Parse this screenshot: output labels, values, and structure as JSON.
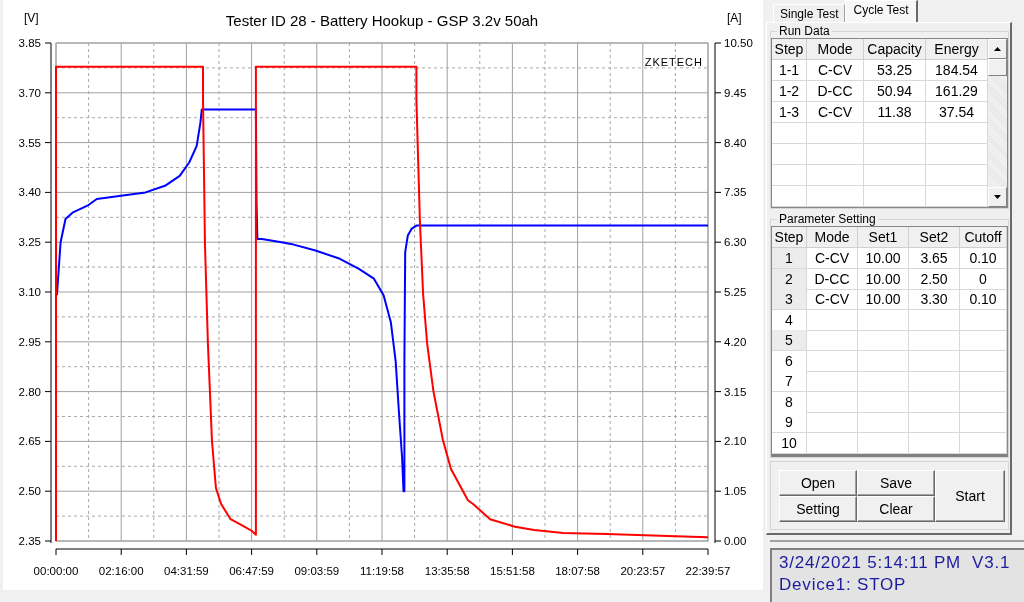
{
  "chart": {
    "brand": "ZKETECH",
    "chart_data": {
      "type": "line",
      "title": "Tester ID 28 - Battery Hookup - GSP 3.2v 50ah",
      "ylabel": "[V]",
      "y2label": "[A]",
      "grid": true,
      "xlim": [
        0,
        81597
      ],
      "ylim": [
        2.35,
        3.85
      ],
      "y2lim": [
        0,
        10.5
      ],
      "xticks": [
        {
          "value": 0,
          "label": "00:00:00"
        },
        {
          "value": 8160,
          "label": "02:16:00"
        },
        {
          "value": 16319,
          "label": "04:31:59"
        },
        {
          "value": 24479,
          "label": "06:47:59"
        },
        {
          "value": 32639,
          "label": "09:03:59"
        },
        {
          "value": 40798,
          "label": "11:19:58"
        },
        {
          "value": 48958,
          "label": "13:35:58"
        },
        {
          "value": 57118,
          "label": "15:51:58"
        },
        {
          "value": 65278,
          "label": "18:07:58"
        },
        {
          "value": 73437,
          "label": "20:23:57"
        },
        {
          "value": 81597,
          "label": "22:39:57"
        }
      ],
      "yticks": [
        {
          "value": 3.85,
          "label": "3.85"
        },
        {
          "value": 3.7,
          "label": "3.70"
        },
        {
          "value": 3.55,
          "label": "3.55"
        },
        {
          "value": 3.4,
          "label": "3.40"
        },
        {
          "value": 3.25,
          "label": "3.25"
        },
        {
          "value": 3.1,
          "label": "3.10"
        },
        {
          "value": 2.95,
          "label": "2.95"
        },
        {
          "value": 2.8,
          "label": "2.80"
        },
        {
          "value": 2.65,
          "label": "2.65"
        },
        {
          "value": 2.5,
          "label": "2.50"
        },
        {
          "value": 2.35,
          "label": "2.35"
        }
      ],
      "y2ticks": [
        {
          "value": 10.5,
          "label": "10.50"
        },
        {
          "value": 9.45,
          "label": "9.45"
        },
        {
          "value": 8.4,
          "label": "8.40"
        },
        {
          "value": 7.35,
          "label": "7.35"
        },
        {
          "value": 6.3,
          "label": "6.30"
        },
        {
          "value": 5.25,
          "label": "5.25"
        },
        {
          "value": 4.2,
          "label": "4.20"
        },
        {
          "value": 3.15,
          "label": "3.15"
        },
        {
          "value": 2.1,
          "label": "2.10"
        },
        {
          "value": 1.05,
          "label": "1.05"
        },
        {
          "value": 0,
          "label": "0.00"
        }
      ],
      "series": [
        {
          "color": "#0000ff",
          "x": [
            108,
            288,
            576,
            1188,
            2124,
            3924,
            5112,
            8136,
            11196,
            13644,
            15480,
            16668,
            17604,
            18072,
            18252,
            25020,
            25092,
            25200,
            25776,
            28224,
            29412,
            32472,
            35532,
            37908,
            39780,
            41004,
            41904,
            42516,
            42912,
            43308,
            43488,
            43596,
            43596,
            43704,
            44028,
            44496,
            45108,
            81597
          ],
          "values": [
            3.09,
            3.15,
            3.25,
            3.32,
            3.34,
            3.36,
            3.38,
            3.39,
            3.4,
            3.42,
            3.45,
            3.49,
            3.54,
            3.61,
            3.65,
            3.65,
            3.37,
            3.26,
            3.26,
            3.25,
            3.245,
            3.225,
            3.2,
            3.17,
            3.14,
            3.09,
            3.01,
            2.89,
            2.74,
            2.6,
            2.5,
            2.5,
            2.89,
            3.22,
            3.27,
            3.29,
            3.3,
            3.3
          ]
        },
        {
          "color": "#ff0000",
          "axis": "y2",
          "x": [
            0,
            0,
            18396,
            18396,
            18648,
            19008,
            19260,
            19512,
            20016,
            20664,
            21852,
            23400,
            24516,
            25020,
            25020,
            45108,
            45108,
            45540,
            45936,
            46440,
            47232,
            48420,
            49428,
            51552,
            52200,
            54324,
            57456,
            59832,
            63468,
            68940,
            75600,
            81597
          ],
          "values": [
            0,
            10.0,
            10.0,
            9.3,
            6.22,
            4.17,
            3.16,
            2.13,
            1.12,
            0.78,
            0.46,
            0.32,
            0.21,
            0.13,
            10.0,
            10.0,
            9.3,
            6.75,
            5.21,
            4.17,
            3.16,
            2.13,
            1.52,
            0.86,
            0.78,
            0.46,
            0.3,
            0.23,
            0.17,
            0.15,
            0.11,
            0.08
          ]
        }
      ]
    }
  },
  "tabs": [
    {
      "label": "Single Test",
      "selected": false
    },
    {
      "label": "Cycle Test",
      "selected": true
    }
  ],
  "run_data": {
    "title": "Run Data",
    "columns": [
      "Step",
      "Mode",
      "Capacity",
      "Energy"
    ],
    "rows": [
      [
        "1-1",
        "C-CV",
        "53.25",
        "184.54"
      ],
      [
        "1-2",
        "D-CC",
        "50.94",
        "161.29"
      ],
      [
        "1-3",
        "C-CV",
        "11.38",
        "37.54"
      ]
    ]
  },
  "parameter_setting": {
    "title": "Parameter Setting",
    "columns": [
      "Step",
      "Mode",
      "Set1",
      "Set2",
      "Cutoff"
    ],
    "rows": [
      {
        "cells": [
          "1",
          "C-CV",
          "10.00",
          "3.65",
          "0.10"
        ],
        "highlighted": true
      },
      {
        "cells": [
          "2",
          "D-CC",
          "10.00",
          "2.50",
          "0"
        ],
        "highlighted": true
      },
      {
        "cells": [
          "3",
          "C-CV",
          "10.00",
          "3.30",
          "0.10"
        ],
        "highlighted": true
      },
      {
        "cells": [
          "4"
        ],
        "highlighted": false
      },
      {
        "cells": [
          "5"
        ],
        "highlighted": true
      },
      {
        "cells": [
          "6"
        ],
        "highlighted": false
      },
      {
        "cells": [
          "7"
        ],
        "highlighted": false
      },
      {
        "cells": [
          "8"
        ],
        "highlighted": false
      },
      {
        "cells": [
          "9"
        ],
        "highlighted": false
      },
      {
        "cells": [
          "10"
        ],
        "highlighted": false
      }
    ]
  },
  "buttons": [
    {
      "label": "Open",
      "kind": "small"
    },
    {
      "label": "Save",
      "kind": "small"
    },
    {
      "label": "Start",
      "kind": "large"
    },
    {
      "label": "Setting",
      "kind": "small"
    },
    {
      "label": "Clear",
      "kind": "small"
    }
  ],
  "status": {
    "lines": [
      "3/24/2021 5:14:11 PM  V3.1",
      "Device1: STOP"
    ]
  }
}
